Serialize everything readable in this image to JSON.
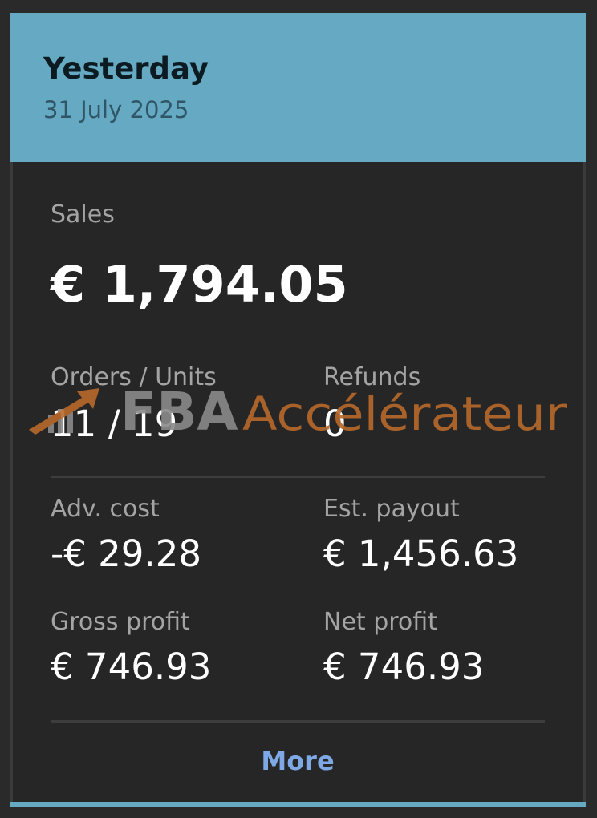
{
  "header": {
    "title": "Yesterday",
    "date": "31 July 2025"
  },
  "sales": {
    "label": "Sales",
    "value": "€ 1,794.05"
  },
  "orders_units": {
    "label": "Orders / Units",
    "value": "11 / 19"
  },
  "refunds": {
    "label": "Refunds",
    "value": "0"
  },
  "adv_cost": {
    "label": "Adv. cost",
    "value": "-€ 29.28"
  },
  "est_payout": {
    "label": "Est. payout",
    "value": "€ 1,456.63"
  },
  "gross_profit": {
    "label": "Gross profit",
    "value": "€ 746.93"
  },
  "net_profit": {
    "label": "Net profit",
    "value": "€ 746.93"
  },
  "more_label": "More",
  "watermark": {
    "text_fba": "FBA",
    "text_acc": "Accélérateur",
    "color_gray": "#8a8a8a",
    "color_orange": "#b8692a"
  },
  "colors": {
    "header_bg": "#65aac2",
    "card_bg": "#262626",
    "link": "#7fa9e6"
  }
}
